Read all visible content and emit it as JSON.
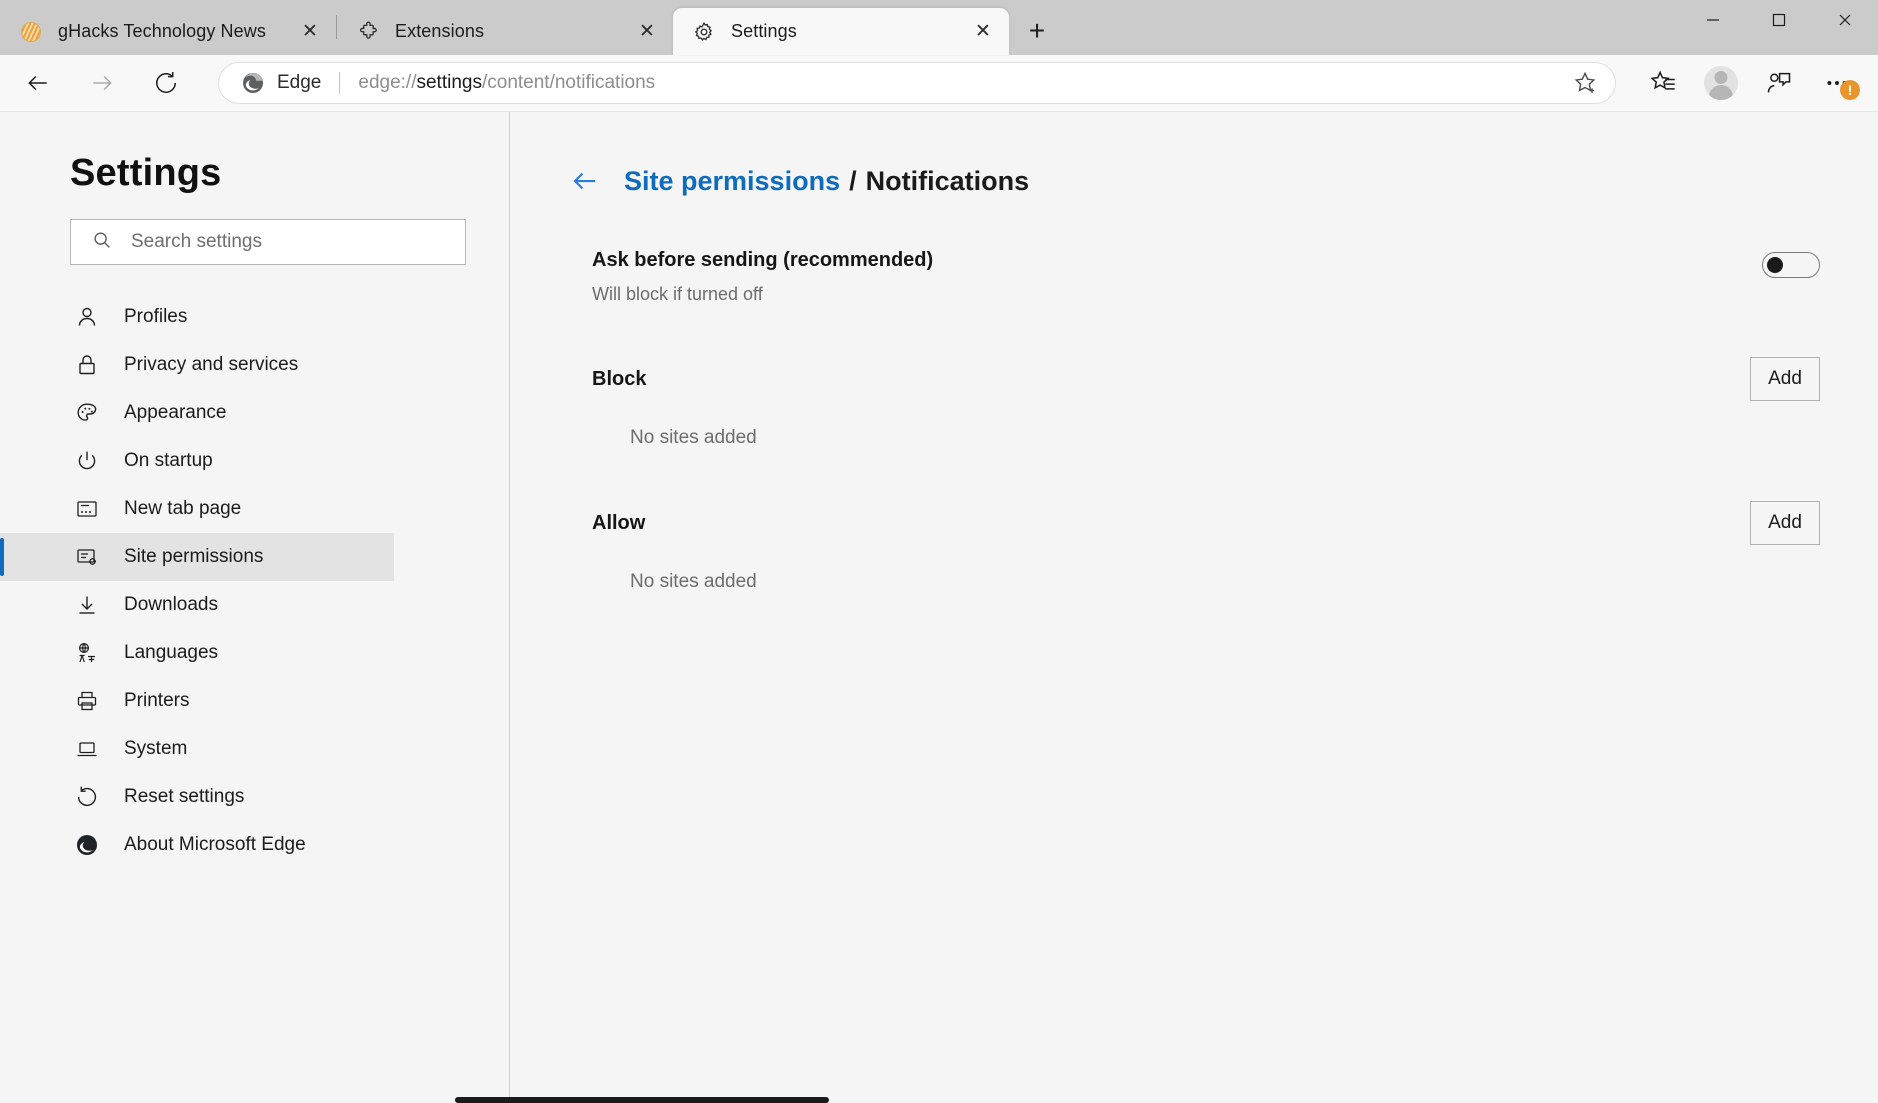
{
  "window": {
    "controls": {
      "minimize": "—",
      "maximize": "□",
      "close": "✕"
    }
  },
  "tabs": [
    {
      "title": "gHacks Technology News",
      "icon": "ghacks-favicon",
      "active": false,
      "close": "✕"
    },
    {
      "title": "Extensions",
      "icon": "puzzle-piece-icon",
      "active": false,
      "close": "✕"
    },
    {
      "title": "Settings",
      "icon": "gear-icon",
      "active": true,
      "close": "✕"
    }
  ],
  "newtab_label": "+",
  "toolbar": {
    "back_icon": "back-arrow-icon",
    "forward_icon": "forward-arrow-icon",
    "reload_icon": "reload-icon",
    "edge_label": "Edge",
    "url_prefix": "edge://",
    "url_strong": "settings",
    "url_suffix": "/content/notifications",
    "url_full": "edge://settings/content/notifications",
    "favorite_icon": "favorite-star-icon",
    "collections_icon": "favorites-list-icon",
    "profile_icon": "profile-avatar-icon",
    "feedback_icon": "feedback-icon",
    "more_icon": "more-options-icon",
    "alert_badge": "!"
  },
  "sidebar": {
    "title": "Settings",
    "search": {
      "placeholder": "Search settings",
      "value": "",
      "icon": "search-icon"
    },
    "items": [
      {
        "label": "Profiles",
        "icon": "person-icon",
        "selected": false
      },
      {
        "label": "Privacy and services",
        "icon": "lock-icon",
        "selected": false
      },
      {
        "label": "Appearance",
        "icon": "palette-icon",
        "selected": false
      },
      {
        "label": "On startup",
        "icon": "power-icon",
        "selected": false
      },
      {
        "label": "New tab page",
        "icon": "new-tab-page-icon",
        "selected": false
      },
      {
        "label": "Site permissions",
        "icon": "site-settings-icon",
        "selected": true
      },
      {
        "label": "Downloads",
        "icon": "download-icon",
        "selected": false
      },
      {
        "label": "Languages",
        "icon": "languages-icon",
        "selected": false
      },
      {
        "label": "Printers",
        "icon": "printer-icon",
        "selected": false
      },
      {
        "label": "System",
        "icon": "laptop-icon",
        "selected": false
      },
      {
        "label": "Reset settings",
        "icon": "reset-icon",
        "selected": false
      },
      {
        "label": "About Microsoft Edge",
        "icon": "edge-logo-icon",
        "selected": false
      }
    ]
  },
  "main": {
    "breadcrumb": {
      "back_icon": "back-arrow-icon",
      "parent": "Site permissions",
      "separator": "/",
      "current": "Notifications"
    },
    "ask_section": {
      "title": "Ask before sending (recommended)",
      "subtitle": "Will block if turned off",
      "toggle_state": "off"
    },
    "block_section": {
      "title": "Block",
      "add_label": "Add",
      "empty_text": "No sites added"
    },
    "allow_section": {
      "title": "Allow",
      "add_label": "Add",
      "empty_text": "No sites added"
    }
  },
  "colors": {
    "accent": "#0f6cbd",
    "alert": "#e8952b",
    "titlebar": "#cbcbcb",
    "page_bg": "#f5f5f5"
  }
}
